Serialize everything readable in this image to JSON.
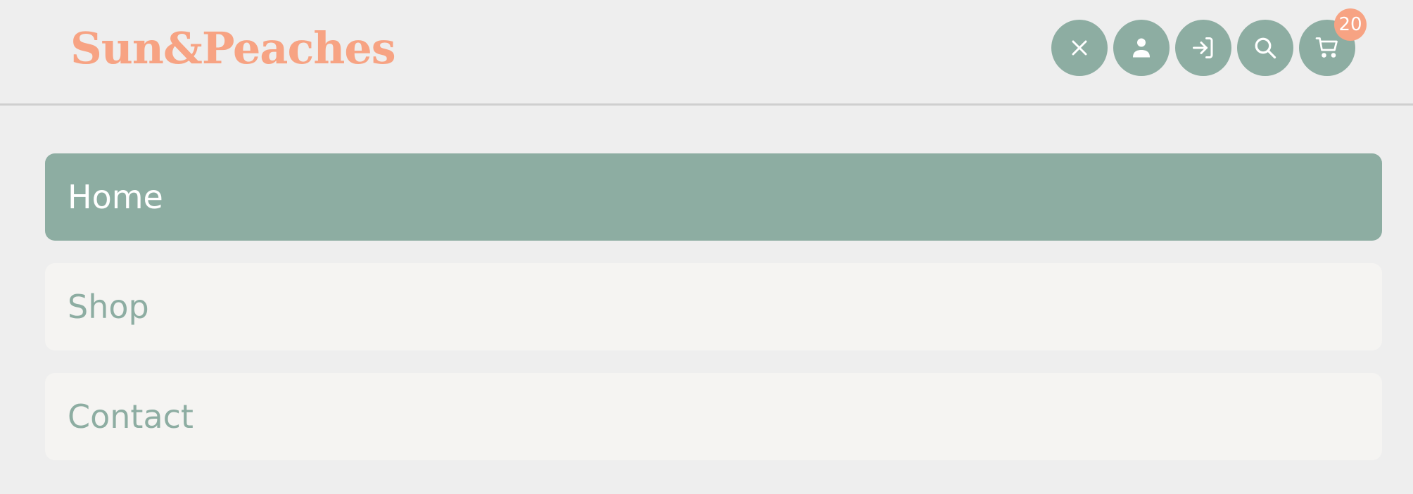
{
  "header": {
    "logo_text": "Sun&Peaches",
    "icons": [
      {
        "name": "close-icon"
      },
      {
        "name": "user-icon"
      },
      {
        "name": "login-icon"
      },
      {
        "name": "search-icon"
      },
      {
        "name": "cart-icon"
      }
    ],
    "cart_count": "20"
  },
  "nav": {
    "items": [
      {
        "label": "Home",
        "active": true
      },
      {
        "label": "Shop",
        "active": false
      },
      {
        "label": "Contact",
        "active": false
      }
    ]
  },
  "colors": {
    "accent": "#8dada2",
    "brand": "#f7a383",
    "background": "#eeeeee",
    "item_bg": "#f5f4f2"
  }
}
